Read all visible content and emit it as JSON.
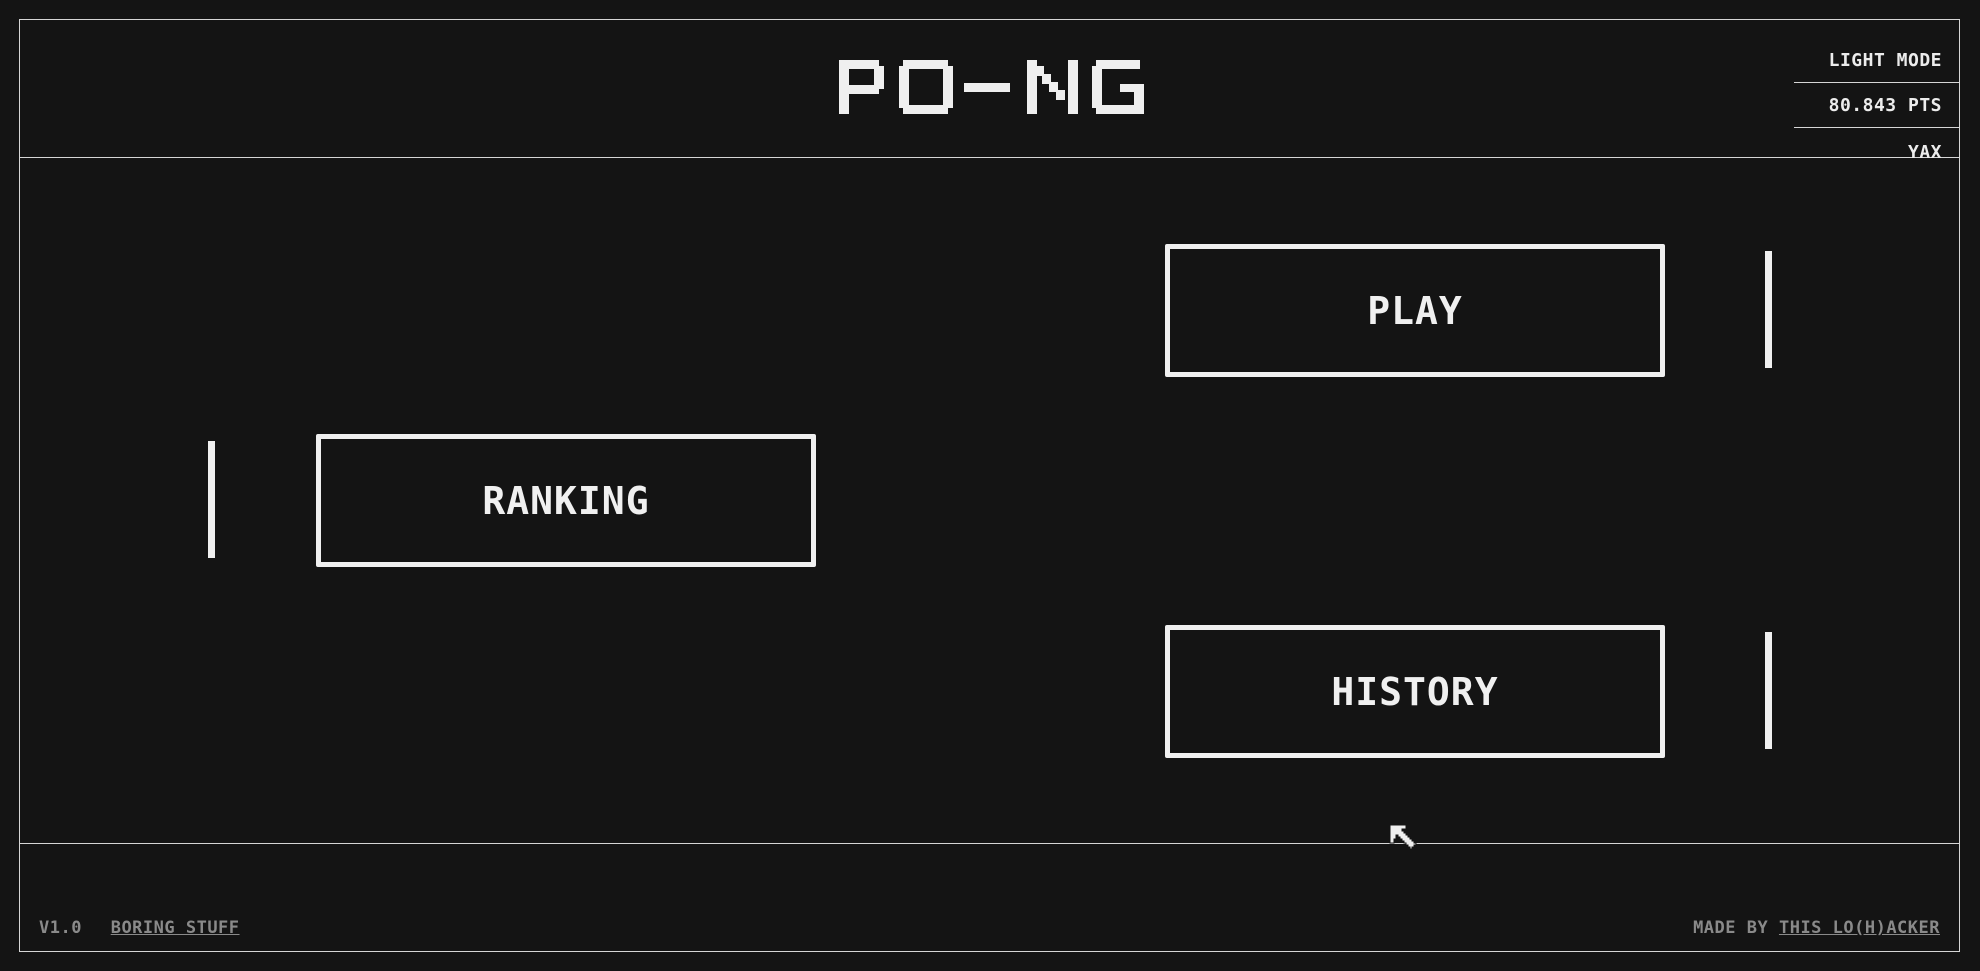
{
  "app": {
    "title": "PO-NG"
  },
  "menu": {
    "items": [
      {
        "label": "LIGHT MODE"
      },
      {
        "label": "80.843 PTS"
      },
      {
        "label": "YAX"
      }
    ]
  },
  "buttons": {
    "play": "PLAY",
    "ranking": "RANKING",
    "history": "HISTORY"
  },
  "footer": {
    "version": "V1.0",
    "boring_link": "BORING STUFF",
    "made_by": "MADE BY",
    "author_link": "THIS LO(H)ACKER"
  },
  "colors": {
    "background": "#141414",
    "foreground": "#f0f0f0",
    "muted": "#8a8a8a",
    "lines": "#d6d6d6"
  },
  "icons": {
    "cursor": "pixel-arrow-cursor-icon"
  }
}
